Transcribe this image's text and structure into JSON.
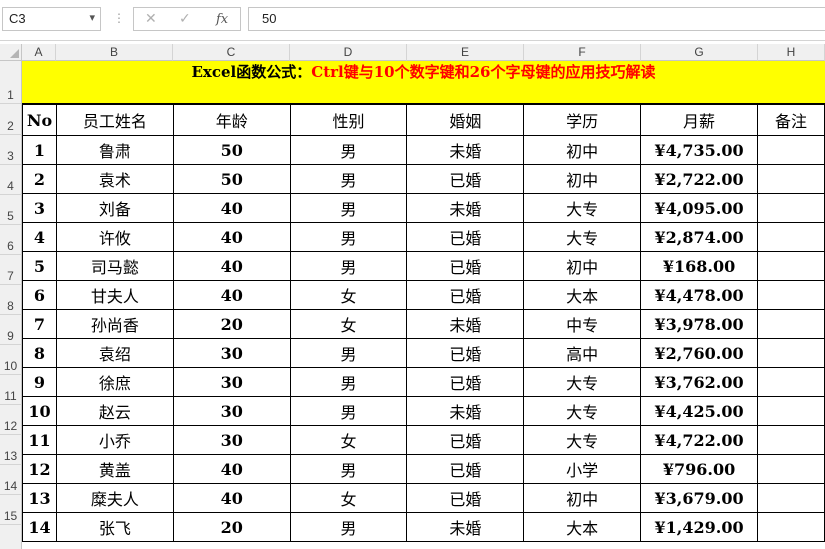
{
  "name_box": {
    "value": "C3"
  },
  "formula_bar": {
    "value": "50"
  },
  "column_headers": [
    "A",
    "B",
    "C",
    "D",
    "E",
    "F",
    "G",
    "H"
  ],
  "row_numbers": [
    "1",
    "2",
    "3",
    "4",
    "5",
    "6",
    "7",
    "8",
    "9",
    "10",
    "11",
    "12",
    "13",
    "14",
    "15"
  ],
  "title": {
    "black_part": "Excel函数公式：",
    "red_part": "Ctrl键与10个数字键和26个字母键的应用技巧解读"
  },
  "table": {
    "headers": [
      "No",
      "员工姓名",
      "年龄",
      "性别",
      "婚姻",
      "学历",
      "月薪",
      "备注"
    ],
    "rows": [
      [
        "1",
        "鲁肃",
        "50",
        "男",
        "未婚",
        "初中",
        "¥4,735.00",
        ""
      ],
      [
        "2",
        "袁术",
        "50",
        "男",
        "已婚",
        "初中",
        "¥2,722.00",
        ""
      ],
      [
        "3",
        "刘备",
        "40",
        "男",
        "未婚",
        "大专",
        "¥4,095.00",
        ""
      ],
      [
        "4",
        "许攸",
        "40",
        "男",
        "已婚",
        "大专",
        "¥2,874.00",
        ""
      ],
      [
        "5",
        "司马懿",
        "40",
        "男",
        "已婚",
        "初中",
        "¥168.00",
        ""
      ],
      [
        "6",
        "甘夫人",
        "40",
        "女",
        "已婚",
        "大本",
        "¥4,478.00",
        ""
      ],
      [
        "7",
        "孙尚香",
        "20",
        "女",
        "未婚",
        "中专",
        "¥3,978.00",
        ""
      ],
      [
        "8",
        "袁绍",
        "30",
        "男",
        "已婚",
        "高中",
        "¥2,760.00",
        ""
      ],
      [
        "9",
        "徐庶",
        "30",
        "男",
        "已婚",
        "大专",
        "¥3,762.00",
        ""
      ],
      [
        "10",
        "赵云",
        "30",
        "男",
        "未婚",
        "大专",
        "¥4,425.00",
        ""
      ],
      [
        "11",
        "小乔",
        "30",
        "女",
        "已婚",
        "大专",
        "¥4,722.00",
        ""
      ],
      [
        "12",
        "黄盖",
        "40",
        "男",
        "已婚",
        "小学",
        "¥796.00",
        ""
      ],
      [
        "13",
        "糜夫人",
        "40",
        "女",
        "已婚",
        "初中",
        "¥3,679.00",
        ""
      ],
      [
        "14",
        "张飞",
        "20",
        "男",
        "未婚",
        "大本",
        "¥1,429.00",
        ""
      ]
    ]
  }
}
